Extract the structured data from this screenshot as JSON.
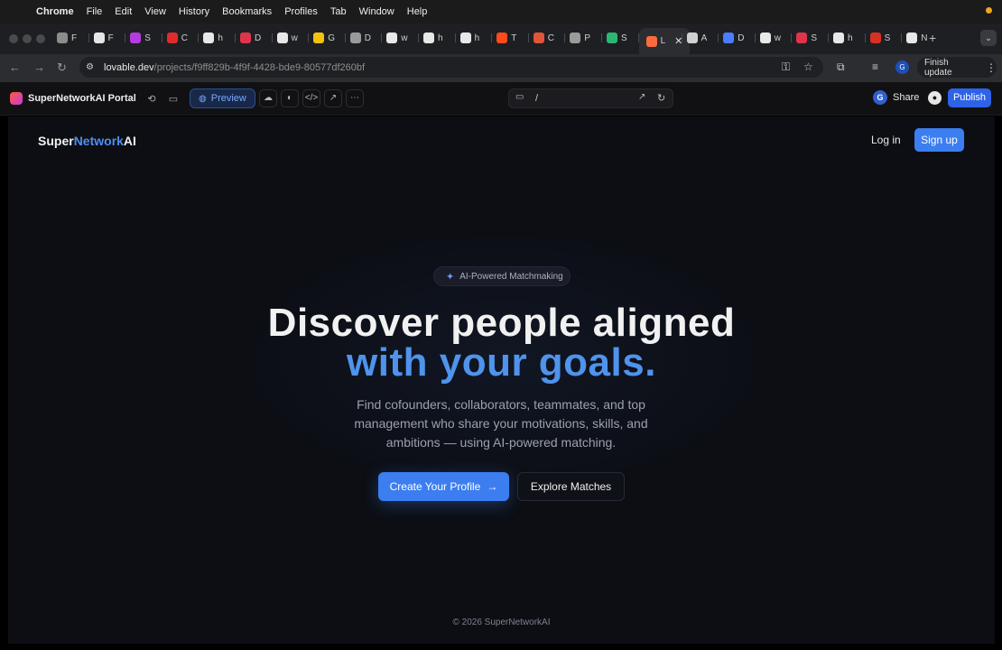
{
  "menubar": {
    "app": "Chrome",
    "items": [
      "File",
      "Edit",
      "View",
      "History",
      "Bookmarks",
      "Profiles",
      "Tab",
      "Window",
      "Help"
    ]
  },
  "tabs": {
    "items": [
      {
        "label": "F",
        "icon": "app-icon",
        "color": "#8c8c8c"
      },
      {
        "label": "F",
        "icon": "app-icon",
        "color": "#e6e6e6"
      },
      {
        "label": "S",
        "icon": "app-icon",
        "color": "#b43be0"
      },
      {
        "label": "C",
        "icon": "youtube-icon",
        "color": "#e02b2b"
      },
      {
        "label": "h",
        "icon": "google-icon",
        "color": "#e8e8e8"
      },
      {
        "label": "D",
        "icon": "heart-icon",
        "color": "#e0344a"
      },
      {
        "label": "w",
        "icon": "google-icon",
        "color": "#e8e8e8"
      },
      {
        "label": "G",
        "icon": "app-icon",
        "color": "#f4c20d"
      },
      {
        "label": "D",
        "icon": "app-icon",
        "color": "#9a9a9a"
      },
      {
        "label": "w",
        "icon": "google-icon",
        "color": "#e8e8e8"
      },
      {
        "label": "h",
        "icon": "google-icon",
        "color": "#e8e8e8"
      },
      {
        "label": "h",
        "icon": "google-icon",
        "color": "#e8e8e8"
      },
      {
        "label": "T",
        "icon": "app-icon",
        "color": "#ff4a1c"
      },
      {
        "label": "C",
        "icon": "app-icon",
        "color": "#e0553a"
      },
      {
        "label": "P",
        "icon": "app-icon",
        "color": "#9a9a9a"
      },
      {
        "label": "S",
        "icon": "app-icon",
        "color": "#2bb673"
      },
      {
        "label": "L",
        "icon": "app-icon",
        "color": "#ff6b3d",
        "active": true
      },
      {
        "label": "A",
        "icon": "app-icon",
        "color": "#d0d0d0"
      },
      {
        "label": "D",
        "icon": "app-icon",
        "color": "#4a7dff"
      },
      {
        "label": "w",
        "icon": "google-icon",
        "color": "#e8e8e8"
      },
      {
        "label": "S",
        "icon": "app-icon",
        "color": "#e0344a"
      },
      {
        "label": "h",
        "icon": "google-icon",
        "color": "#e8e8e8"
      },
      {
        "label": "S",
        "icon": "gmail-icon",
        "color": "#d93025"
      },
      {
        "label": "N",
        "icon": "app-icon",
        "color": "#e8e8e8"
      }
    ],
    "new_tab": "+"
  },
  "address": {
    "host": "lovable.dev",
    "path": "/projects/f9ff829b-4f9f-4428-bde9-80577df260bf",
    "finish_update": "Finish update",
    "profile_initial": "G"
  },
  "editor": {
    "project_name": "SuperNetworkAI Portal",
    "preview_label": "Preview",
    "route": "/",
    "share_label": "Share",
    "share_initial": "G",
    "publish_label": "Publish"
  },
  "site": {
    "brand_part1": "Super",
    "brand_part2": "Network",
    "brand_part3": "AI",
    "login": "Log in",
    "signup": "Sign up",
    "badge": "AI-Powered Matchmaking",
    "headline_line1": "Discover people aligned",
    "headline_line2": "with your goals.",
    "subtitle": "Find cofounders, collaborators, teammates, and top management who share your motivations, skills, and ambitions — using AI-powered matching.",
    "cta_primary": "Create Your Profile",
    "cta_secondary": "Explore Matches",
    "footer": "© 2026 SuperNetworkAI"
  },
  "colors": {
    "accent": "#3c7ef0",
    "headline_accent": "#4f93ec",
    "background": "#0c0e14",
    "publish": "#2e63e8"
  }
}
